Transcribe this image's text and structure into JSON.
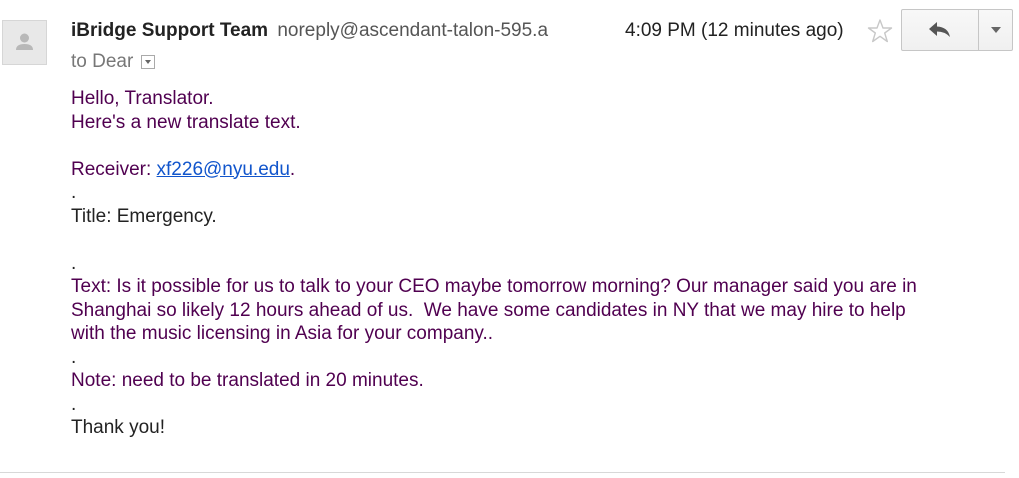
{
  "header": {
    "sender_name": "iBridge Support Team",
    "sender_email": "noreply@ascendant-talon-595.a",
    "time": "4:09 PM (12 minutes ago)",
    "to_label": "to Dear"
  },
  "icons": {
    "avatar": "person-avatar-icon",
    "star": "star-outline-icon",
    "reply": "reply-arrow-icon",
    "more": "chevron-down-icon",
    "to_details": "dropdown-arrow-icon"
  },
  "colors": {
    "body_text": "#500050",
    "link": "#1155cc",
    "sender": "#222222"
  },
  "body": {
    "greeting": "Hello, Translator.",
    "intro": "Here's a new translate text.",
    "receiver_label": "Receiver: ",
    "receiver_email": "xf226@nyu.edu",
    "receiver_end": ".",
    "dot1": ".",
    "title_line": "Title: Emergency.",
    "dot2": ".",
    "text_line1": "Text: Is it possible for us to talk to your CEO maybe tomorrow morning? Our manager said you are in",
    "text_line2": "Shanghai so likely 12 hours ahead of us.  We have some candidates in NY that we may hire to help",
    "text_line3": "with the music licensing in Asia for your company..",
    "dot3": ".",
    "note_line": "Note: need to be translated in 20 minutes.",
    "dot4": ".",
    "thanks": "Thank you!"
  }
}
